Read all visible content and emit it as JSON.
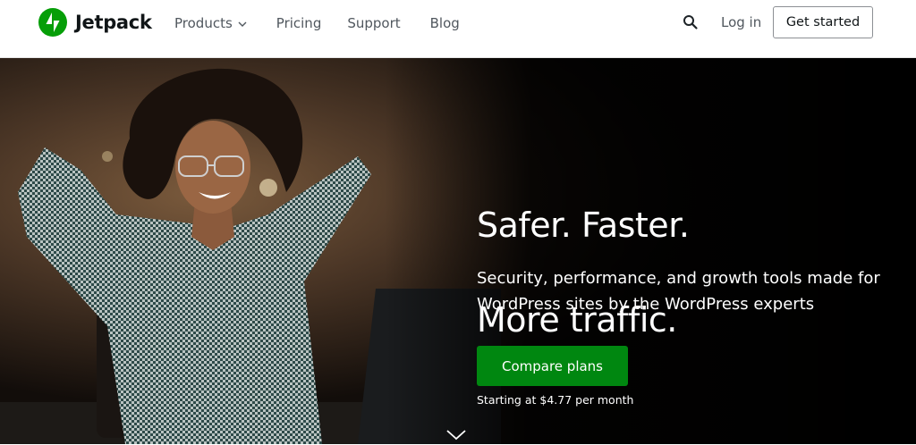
{
  "brand": {
    "name": "Jetpack",
    "accent": "#069e08"
  },
  "nav": {
    "products": "Products",
    "pricing": "Pricing",
    "support": "Support",
    "blog": "Blog"
  },
  "header_actions": {
    "search_icon": "search-icon",
    "login": "Log in",
    "get_started": "Get started"
  },
  "hero": {
    "title_line1": "Safer. Faster.",
    "title_line2": "More traffic.",
    "subtitle": "Security, performance, and growth tools made for WordPress sites by the WordPress experts",
    "cta": "Compare plans",
    "cta_color": "#008710",
    "price_note": "Starting at $4.77 per month"
  }
}
